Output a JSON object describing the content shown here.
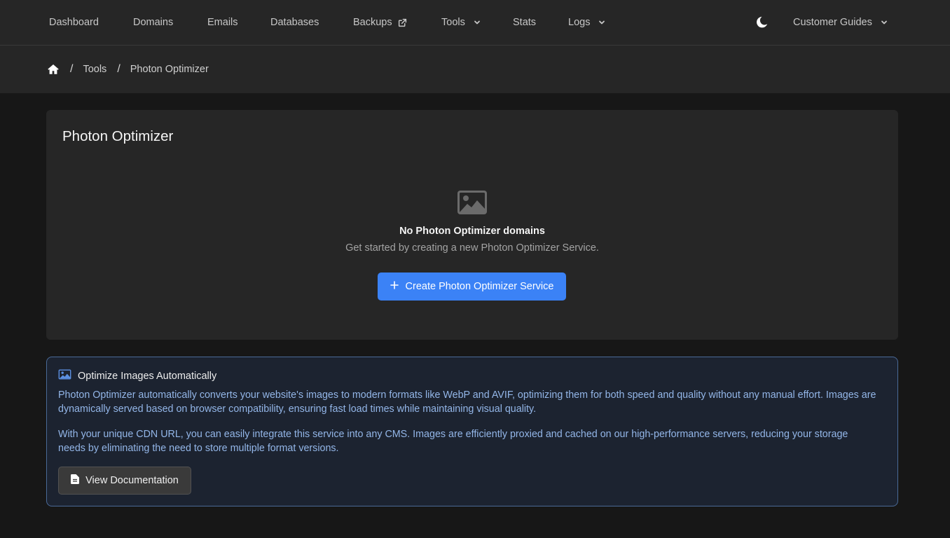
{
  "nav": {
    "dashboard": "Dashboard",
    "domains": "Domains",
    "emails": "Emails",
    "databases": "Databases",
    "backups": "Backups",
    "tools": "Tools",
    "stats": "Stats",
    "logs": "Logs",
    "customer_guides": "Customer Guides"
  },
  "icons": {
    "external": "external-link-icon",
    "chevron": "chevron-down-icon",
    "theme": "moon-icon",
    "home": "home-icon",
    "empty": "image-icon",
    "plus": "plus-icon",
    "info": "image-icon",
    "doc": "document-icon"
  },
  "breadcrumb": {
    "separator": "/",
    "tools": "Tools",
    "current": "Photon Optimizer"
  },
  "card": {
    "title": "Photon Optimizer",
    "empty_title": "No Photon Optimizer domains",
    "empty_subtitle": "Get started by creating a new Photon Optimizer Service.",
    "create_button": "Create Photon Optimizer Service"
  },
  "info": {
    "heading": "Optimize Images Automatically",
    "paragraph1": "Photon Optimizer automatically converts your website's images to modern formats like WebP and AVIF, optimizing them for both speed and quality without any manual effort. Images are dynamically served based on browser compatibility, ensuring fast load times while maintaining visual quality.",
    "paragraph2": "With your unique CDN URL, you can easily integrate this service into any CMS. Images are efficiently proxied and cached on our high-performance servers, reducing your storage needs by eliminating the need to store multiple format versions.",
    "doc_button": "View Documentation"
  },
  "colors": {
    "accent": "#3b82f6",
    "info_text": "#93b6e8",
    "info_border": "#4a6a98"
  }
}
